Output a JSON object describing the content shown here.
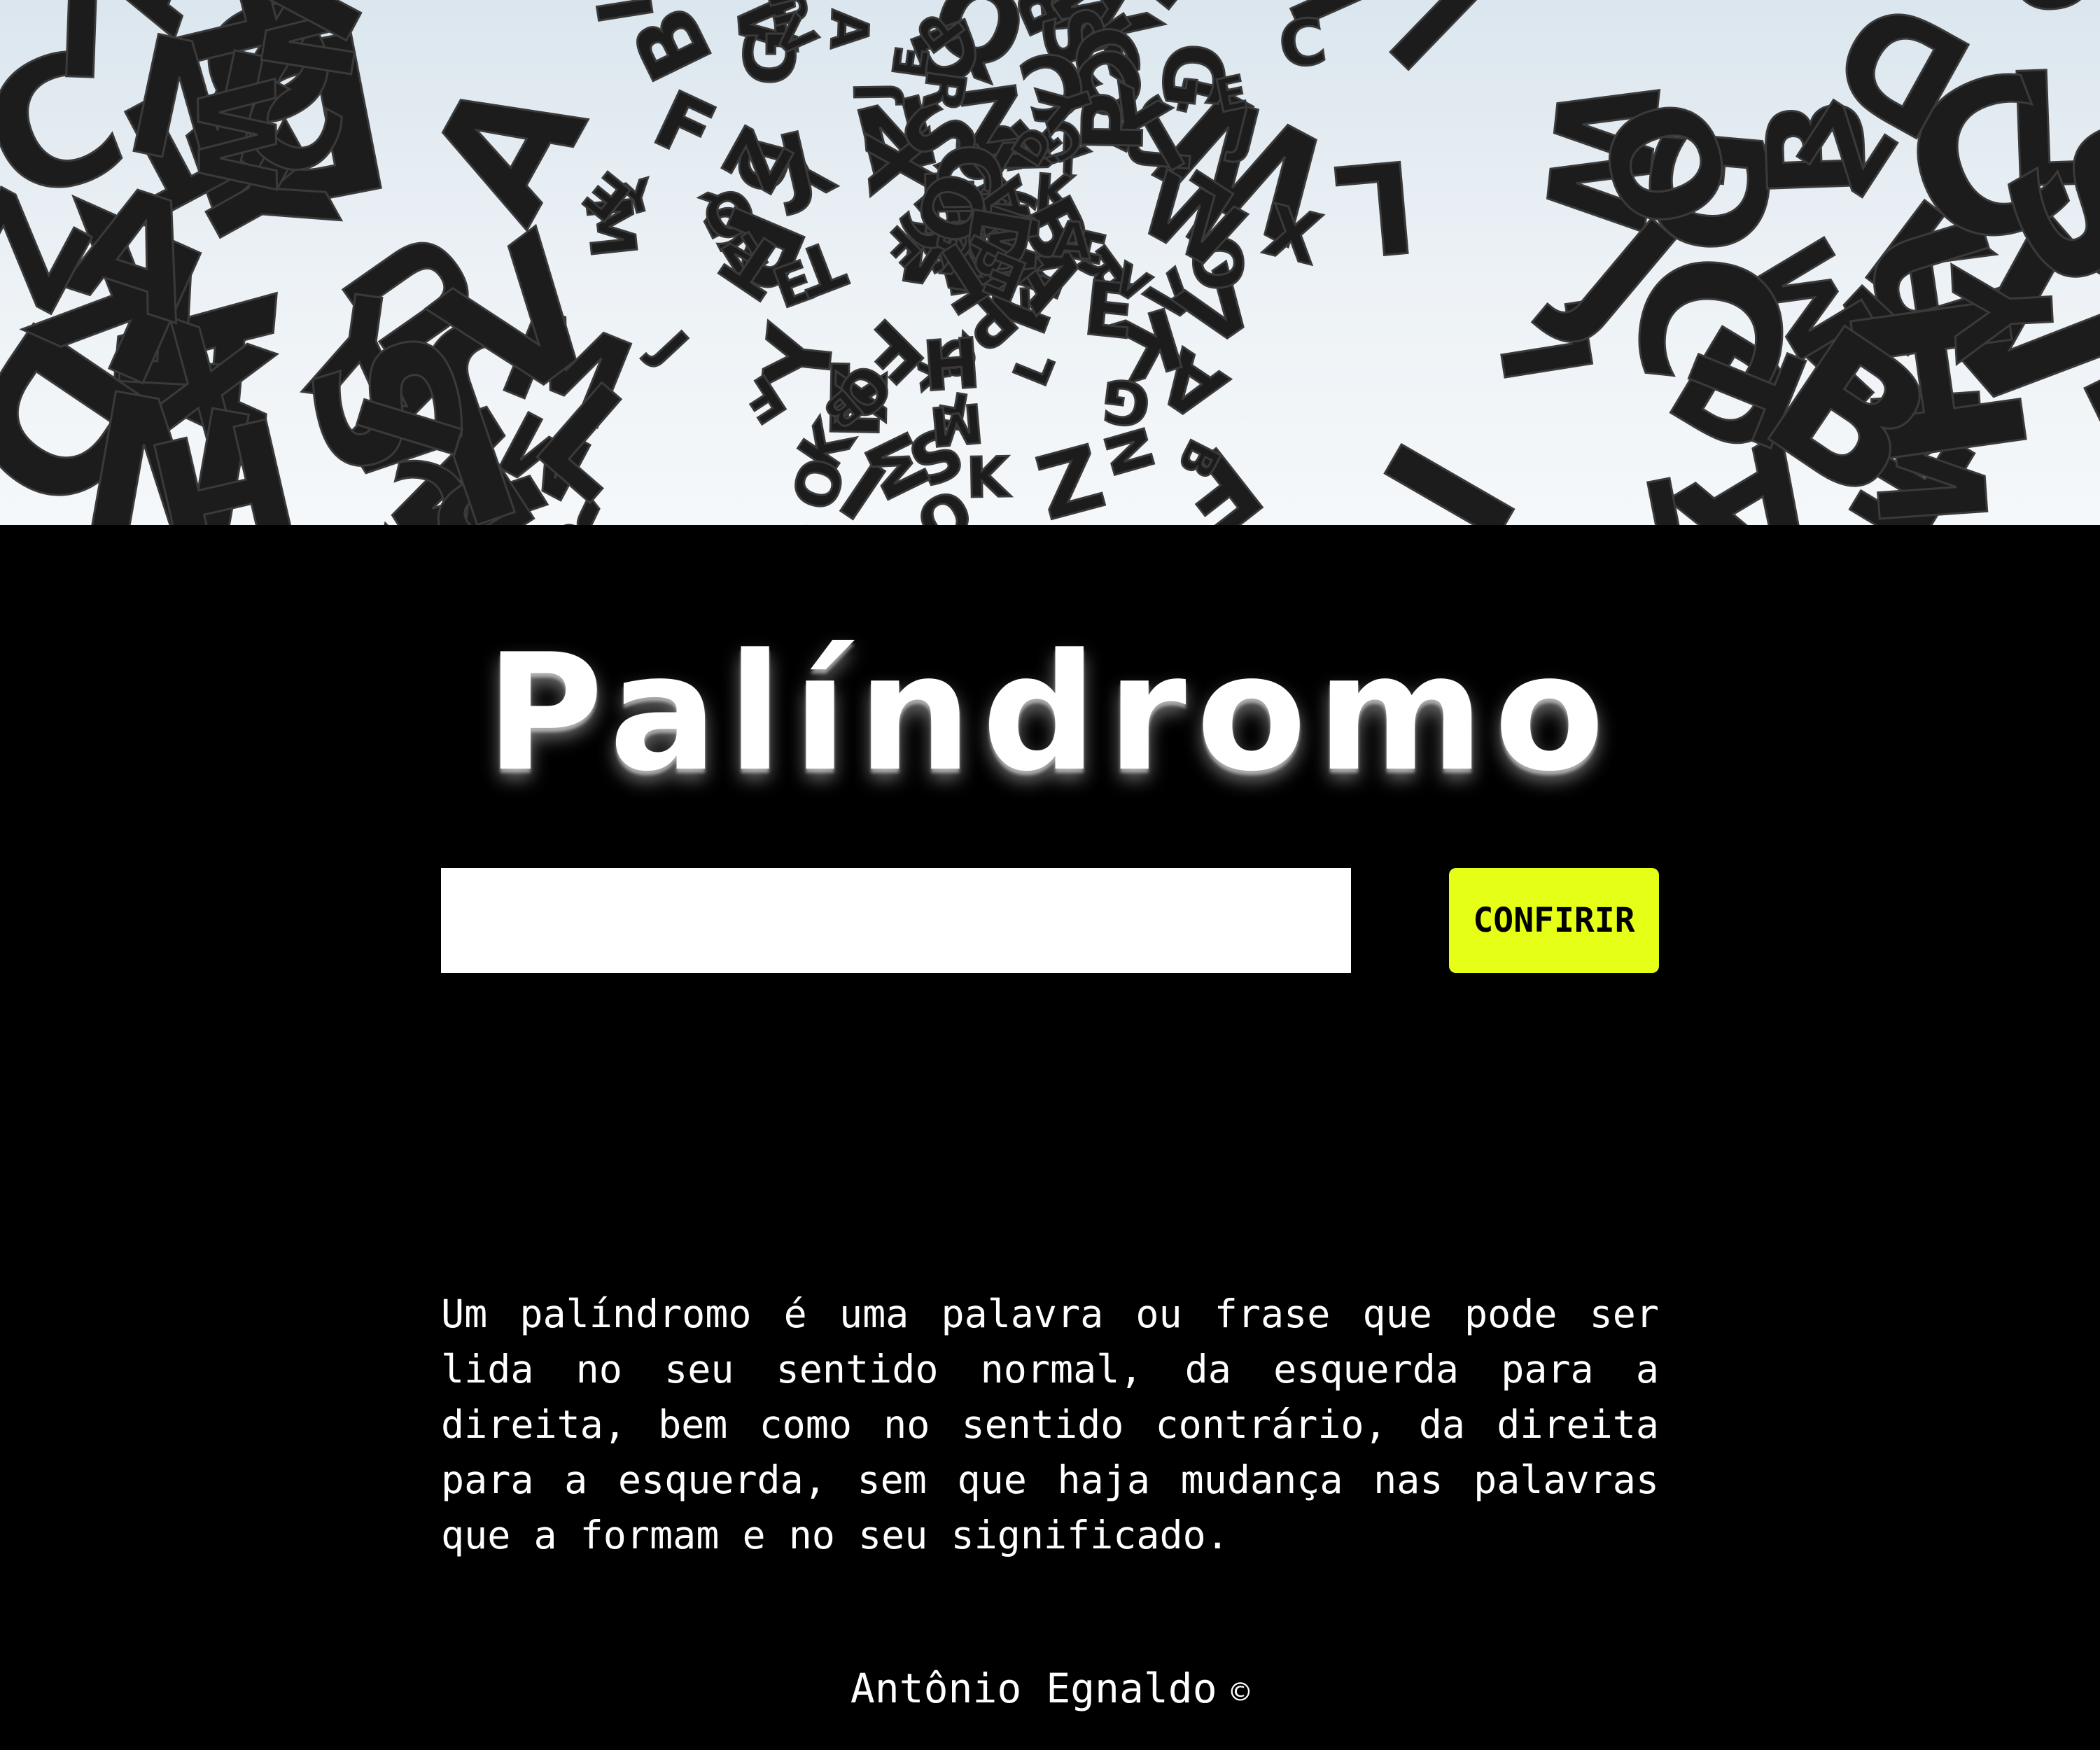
{
  "hero": {
    "image_name": "letter-sculpture-photo"
  },
  "title": "Palíndromo",
  "form": {
    "input_value": "",
    "input_placeholder": "",
    "confirm_label": "CONFIRIR"
  },
  "description": "Um palíndromo é uma palavra ou frase que pode ser lida no seu sentido normal, da esquerda para a direita, bem como no sentido contrário, da direita para a esquerda, sem que haja mudança nas palavras que a formam e no seu significado.",
  "footer": {
    "author": "Antônio Egnaldo",
    "copyright_symbol": "©"
  },
  "colors": {
    "background": "#000000",
    "accent": "#e6ff17",
    "text": "#ffffff"
  }
}
